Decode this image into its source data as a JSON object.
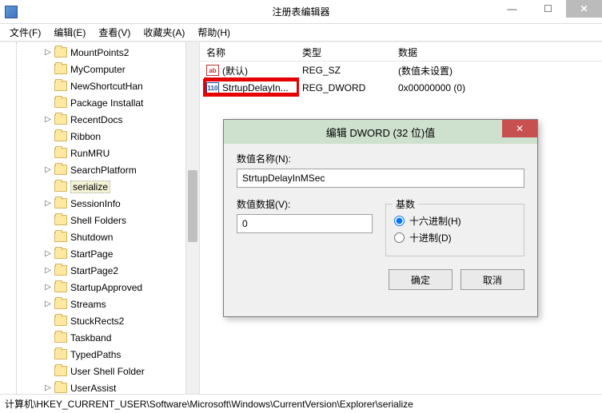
{
  "window": {
    "title": "注册表编辑器",
    "min": "—",
    "max": "☐",
    "close": "✕"
  },
  "menu": {
    "file": "文件(F)",
    "edit": "编辑(E)",
    "view": "查看(V)",
    "favorites": "收藏夹(A)",
    "help": "帮助(H)"
  },
  "tree": {
    "items": [
      {
        "label": "MountPoints2",
        "exp": "▷"
      },
      {
        "label": "MyComputer",
        "exp": ""
      },
      {
        "label": "NewShortcutHan",
        "exp": ""
      },
      {
        "label": "Package Installat",
        "exp": ""
      },
      {
        "label": "RecentDocs",
        "exp": "▷"
      },
      {
        "label": "Ribbon",
        "exp": ""
      },
      {
        "label": "RunMRU",
        "exp": ""
      },
      {
        "label": "SearchPlatform",
        "exp": "▷"
      },
      {
        "label": "serialize",
        "exp": "",
        "selected": true
      },
      {
        "label": "SessionInfo",
        "exp": "▷"
      },
      {
        "label": "Shell Folders",
        "exp": ""
      },
      {
        "label": "Shutdown",
        "exp": ""
      },
      {
        "label": "StartPage",
        "exp": "▷"
      },
      {
        "label": "StartPage2",
        "exp": "▷"
      },
      {
        "label": "StartupApproved",
        "exp": "▷"
      },
      {
        "label": "Streams",
        "exp": "▷"
      },
      {
        "label": "StuckRects2",
        "exp": ""
      },
      {
        "label": "Taskband",
        "exp": ""
      },
      {
        "label": "TypedPaths",
        "exp": ""
      },
      {
        "label": "User Shell Folder",
        "exp": ""
      },
      {
        "label": "UserAssist",
        "exp": "▷"
      }
    ]
  },
  "list": {
    "columns": {
      "name": "名称",
      "type": "类型",
      "data": "数据"
    },
    "rows": [
      {
        "icon": "ab",
        "name": "(默认)",
        "type": "REG_SZ",
        "data": "(数值未设置)"
      },
      {
        "icon": "110",
        "name": "StrtupDelayIn...",
        "type": "REG_DWORD",
        "data": "0x00000000 (0)"
      }
    ]
  },
  "dialog": {
    "title": "编辑 DWORD (32 位)值",
    "close": "✕",
    "name_label": "数值名称(N):",
    "name_value": "StrtupDelayInMSec",
    "data_label": "数值数据(V):",
    "data_value": "0",
    "base_label": "基数",
    "radio_hex": "十六进制(H)",
    "radio_dec": "十进制(D)",
    "ok": "确定",
    "cancel": "取消"
  },
  "statusbar": "计算机\\HKEY_CURRENT_USER\\Software\\Microsoft\\Windows\\CurrentVersion\\Explorer\\serialize"
}
